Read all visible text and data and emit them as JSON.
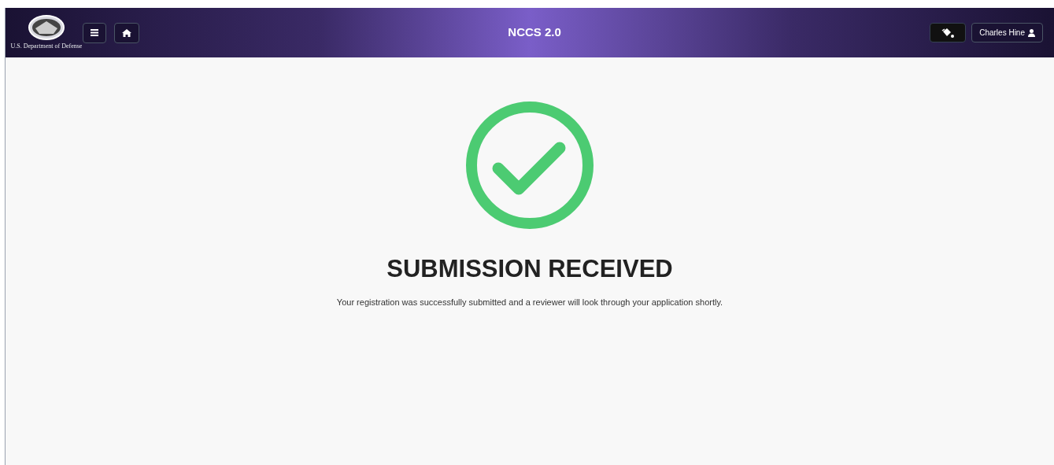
{
  "header": {
    "logo_caption": "U.S. Department of Defense",
    "title": "NCCS 2.0",
    "user_button": "Charles Hine"
  },
  "content": {
    "heading": "SUBMISSION RECEIVED",
    "message": "Your registration was successfully submitted and a reviewer will look through your application shortly."
  }
}
